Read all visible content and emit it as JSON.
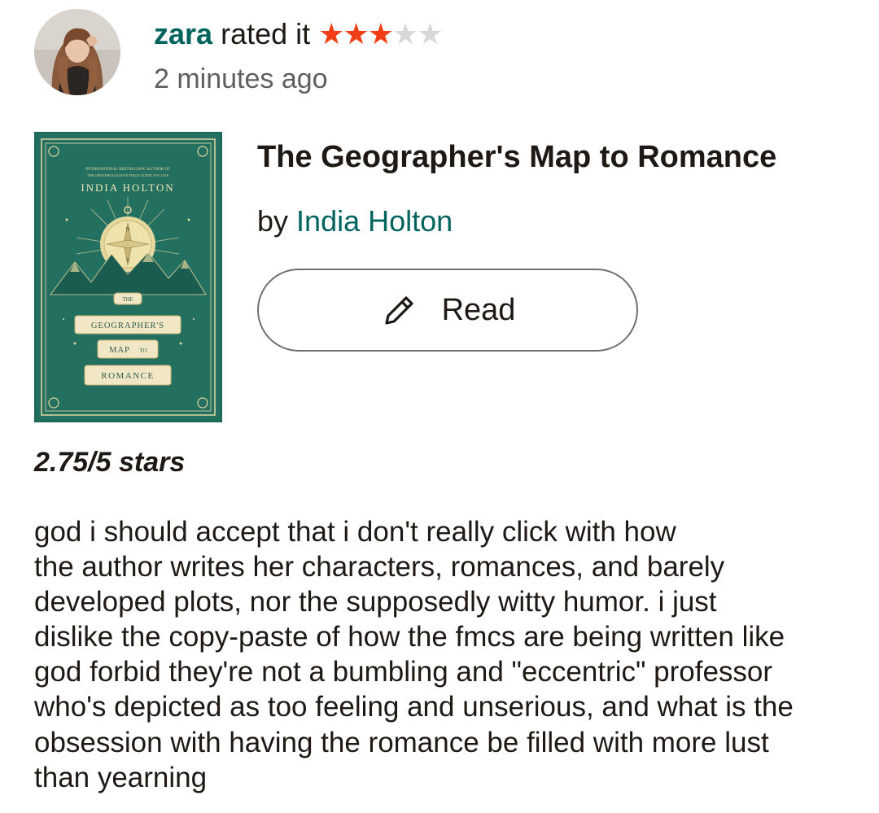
{
  "activity": {
    "username": "zara",
    "action_text": "rated it",
    "rating": {
      "filled": 3,
      "total": 5
    },
    "timestamp": "2 minutes ago"
  },
  "avatar": {
    "icon": "user-avatar-photo"
  },
  "book": {
    "title": "The Geographer's Map to Romance",
    "by_label": "by",
    "author": "India Holton",
    "cover": {
      "tagline_1": "INTERNATIONAL BESTSELLING AUTHOR OF",
      "tagline_2": "THE ORNITHOLOGIST'S FIELD GUIDE TO LOVE",
      "author": "INDIA HOLTON",
      "the": "THE",
      "line_1": "GEOGRAPHER'S",
      "line_2a": "MAP",
      "line_2b": "TO",
      "line_3": "ROMANCE",
      "compass_n": "N",
      "compass_s": "S",
      "background_color": "#1d6a5b",
      "accent_color": "#e6d9a0"
    }
  },
  "read_button": {
    "label": "Read",
    "icon": "pencil-icon"
  },
  "review": {
    "rating_line": "2.75/5 stars",
    "lines": [
      "god i should accept that i don't really click with how",
      "the author writes her characters, romances, and barely",
      "developed plots, nor the supposedly witty humor. i just",
      "dislike the copy-paste of how the fmcs are being written like",
      "god forbid they're not a bumbling and \"eccentric\" professor",
      "who's depicted as too feeling and unserious, and what is the",
      "obsession with having the romance be filled with more lust",
      "than yearning"
    ]
  },
  "colors": {
    "link": "#00635d",
    "star_filled": "#f13e17",
    "star_empty": "#d8d8d8",
    "text": "#1e1915",
    "muted": "#5f5f5f"
  }
}
